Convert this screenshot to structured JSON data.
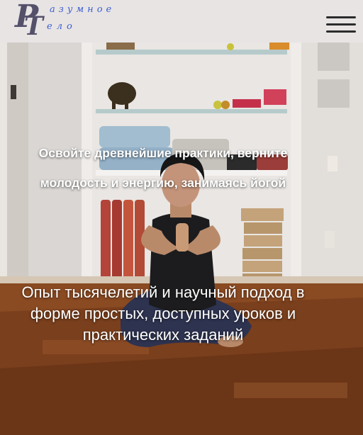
{
  "header": {
    "logo": {
      "letter_p": "Р",
      "letter_t": "Т",
      "word_1": "азумное",
      "word_2": "ело"
    },
    "menu_icon": "hamburger-icon"
  },
  "hero": {
    "title": "Освойте древнейшие практики, верните молодость и энергию, занимаясь йогой",
    "subtitle": "Опыт тысячелетий и научный подход в форме простых, доступных уроков и практических заданий"
  },
  "colors": {
    "header_bg": "#e8e4e4",
    "logo": "#55506a",
    "logo_script": "#3a5fd0",
    "text": "#ffffff"
  }
}
